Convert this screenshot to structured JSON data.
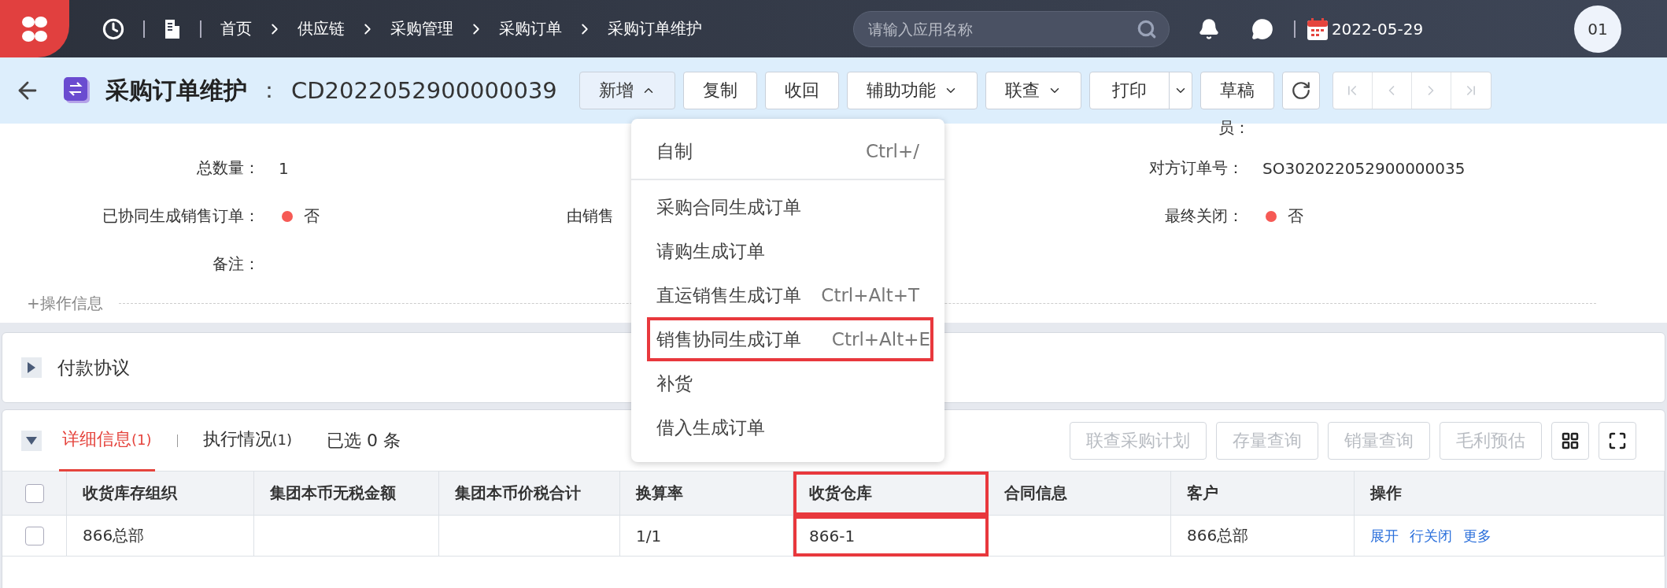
{
  "topbar": {
    "breadcrumbs": [
      "首页",
      "供应链",
      "采购管理",
      "采购订单",
      "采购订单维护"
    ],
    "search": {
      "placeholder": "请输入应用名称"
    },
    "date": "2022-05-29",
    "avatar": "01"
  },
  "header": {
    "title": "采购订单维护",
    "separator": "：",
    "code": "CD2022052900000039",
    "buttons": [
      {
        "kind": "menu",
        "label": "新增",
        "expanded": true
      },
      {
        "kind": "plain",
        "label": "复制"
      },
      {
        "kind": "plain",
        "label": "收回"
      },
      {
        "kind": "menu",
        "label": "辅助功能",
        "expanded": false
      },
      {
        "kind": "menu",
        "label": "联查",
        "expanded": false
      },
      {
        "kind": "split",
        "label": "打印"
      },
      {
        "kind": "plain",
        "label": "草稿"
      },
      {
        "kind": "refresh"
      }
    ],
    "pager_disabled": true
  },
  "menu": [
    {
      "label": "自制",
      "shortcut": "Ctrl+/",
      "highlighted": false,
      "kind": "head"
    },
    {
      "label": "采购合同生成订单",
      "highlighted": false,
      "kind": "item"
    },
    {
      "label": "请购生成订单",
      "highlighted": false,
      "kind": "item"
    },
    {
      "label": "直运销售生成订单",
      "shortcut": "Ctrl+Alt+T",
      "highlighted": false,
      "kind": "item"
    },
    {
      "label": "销售协同生成订单",
      "shortcut": "Ctrl+Alt+E",
      "highlighted": true,
      "kind": "item"
    },
    {
      "label": "补货",
      "highlighted": false,
      "kind": "item"
    },
    {
      "label": "借入生成订单",
      "highlighted": false,
      "kind": "item"
    }
  ],
  "form": {
    "top_right_label": "员：",
    "rows": [
      [
        {
          "label": "总数量：",
          "kind": "text",
          "value": "1"
        },
        {
          "kind": "empty"
        },
        {
          "label": "对方订单号：",
          "kind": "text",
          "value": "SO302022052900000035"
        }
      ],
      [
        {
          "label": "已协同生成销售订单：",
          "kind": "status",
          "value": "否",
          "color": "#f65a55"
        },
        {
          "label": "由销售",
          "kind": "label"
        },
        {
          "label": "最终关闭：",
          "kind": "status",
          "value": "否",
          "color": "#f65a55"
        }
      ],
      [
        {
          "label": "备注：",
          "kind": "text"
        },
        {
          "kind": "empty"
        },
        {
          "kind": "empty"
        }
      ]
    ],
    "ops_info": "+操作信息"
  },
  "payment": {
    "title": "付款协议",
    "expanded": false
  },
  "details": {
    "expanded": true,
    "tabs": [
      {
        "label": "详细信息",
        "count": "(1)",
        "selected": true
      },
      {
        "label": "执行情况",
        "count": "(1)",
        "selected": false
      }
    ],
    "selected_text": "已选 0 条",
    "actions": [
      {
        "label": "联查采购计划",
        "disabled": true
      },
      {
        "label": "存量查询",
        "disabled": true
      },
      {
        "label": "销量查询",
        "disabled": true
      },
      {
        "label": "毛利预估",
        "disabled": true
      }
    ],
    "table": {
      "columns": [
        {
          "label": "收货库存组织",
          "highlighted": false
        },
        {
          "label": "集团本币无税金额",
          "highlighted": false
        },
        {
          "label": "集团本币价税合计",
          "highlighted": false
        },
        {
          "label": "换算率",
          "highlighted": false
        },
        {
          "label": "收货仓库",
          "highlighted": true
        },
        {
          "label": "合同信息",
          "highlighted": false
        },
        {
          "label": "客户",
          "highlighted": false
        },
        {
          "label": "操作",
          "highlighted": false
        }
      ],
      "header_checked": false,
      "rows": [
        {
          "checked": false,
          "cells": [
            "866总部",
            "",
            "",
            "1/1",
            "866-1",
            "",
            "866总部"
          ],
          "actions": [
            "展开",
            "行关闭",
            "更多"
          ]
        }
      ]
    }
  }
}
